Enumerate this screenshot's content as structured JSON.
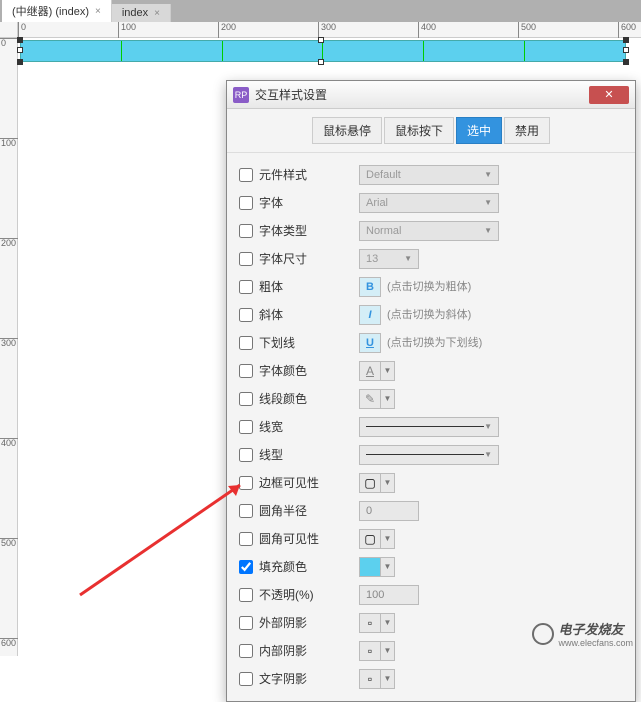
{
  "tabs": [
    {
      "label": "(中继器) (index)"
    },
    {
      "label": "index"
    }
  ],
  "ruler_h": [
    0,
    100,
    200,
    300,
    400,
    500,
    600
  ],
  "ruler_v": [
    0,
    100,
    200,
    300,
    400,
    500,
    600
  ],
  "dialog": {
    "icon": "RP",
    "title": "交互样式设置",
    "tabs": {
      "hover": "鼠标悬停",
      "mousedown": "鼠标按下",
      "selected": "选中",
      "disabled": "禁用"
    }
  },
  "props": {
    "base_style": {
      "label": "元件样式",
      "value": "Default"
    },
    "font": {
      "label": "字体",
      "value": "Arial"
    },
    "font_type": {
      "label": "字体类型",
      "value": "Normal"
    },
    "font_size": {
      "label": "字体尺寸",
      "value": "13"
    },
    "bold": {
      "label": "粗体",
      "letter": "B",
      "hint": "(点击切换为粗体)"
    },
    "italic": {
      "label": "斜体",
      "letter": "I",
      "hint": "(点击切换为斜体)"
    },
    "underline": {
      "label": "下划线",
      "letter": "U",
      "hint": "(点击切换为下划线)"
    },
    "font_color": {
      "label": "字体颜色"
    },
    "line_color": {
      "label": "线段颜色"
    },
    "line_width": {
      "label": "线宽"
    },
    "line_style": {
      "label": "线型"
    },
    "border_vis": {
      "label": "边框可见性"
    },
    "corner_radius": {
      "label": "圆角半径",
      "value": "0"
    },
    "corner_vis": {
      "label": "圆角可见性"
    },
    "fill_color": {
      "label": "填充颜色"
    },
    "opacity": {
      "label": "不透明(%)",
      "value": "100"
    },
    "outer_shadow": {
      "label": "外部阴影"
    },
    "inner_shadow": {
      "label": "内部阴影"
    },
    "text_shadow": {
      "label": "文字阴影"
    }
  },
  "watermark": {
    "brand": "电子发烧友",
    "url": "www.elecfans.com"
  }
}
